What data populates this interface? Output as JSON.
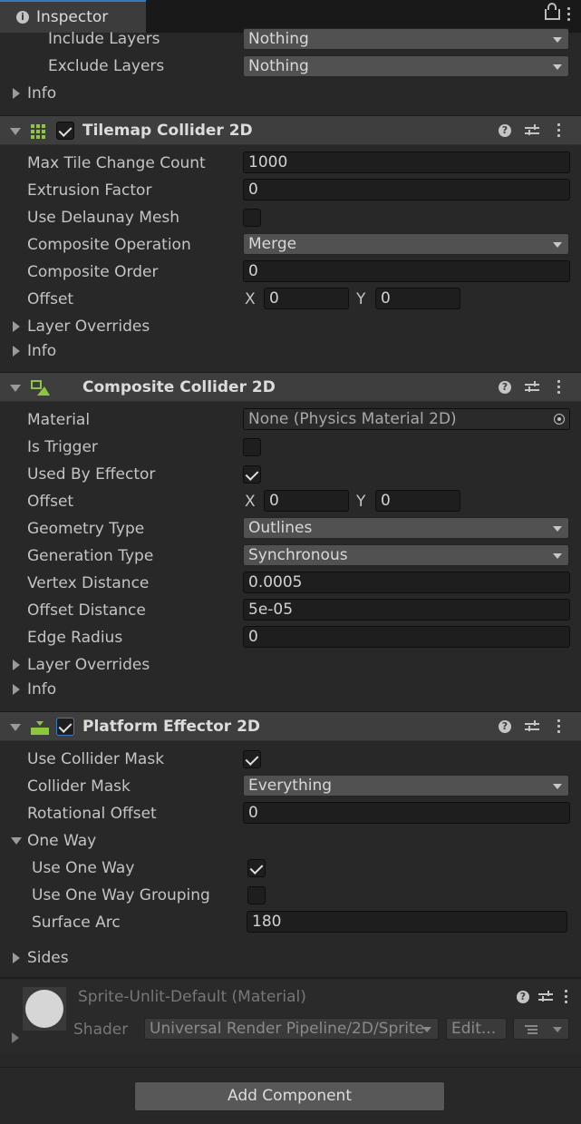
{
  "tab": {
    "title": "Inspector"
  },
  "top": {
    "include_layers": {
      "label": "Include Layers",
      "value": "Nothing"
    },
    "exclude_layers": {
      "label": "Exclude Layers",
      "value": "Nothing"
    },
    "info": "Info"
  },
  "tilemap": {
    "title": "Tilemap Collider 2D",
    "max_tile": {
      "label": "Max Tile Change Count",
      "value": "1000"
    },
    "extrusion": {
      "label": "Extrusion Factor",
      "value": "0"
    },
    "delaunay": {
      "label": "Use Delaunay Mesh"
    },
    "comp_op": {
      "label": "Composite Operation",
      "value": "Merge"
    },
    "comp_order": {
      "label": "Composite Order",
      "value": "0"
    },
    "offset": {
      "label": "Offset",
      "x_label": "X",
      "x": "0",
      "y_label": "Y",
      "y": "0"
    },
    "layer_overrides": "Layer Overrides",
    "info": "Info"
  },
  "composite": {
    "title": "Composite Collider 2D",
    "material": {
      "label": "Material",
      "value": "None (Physics Material 2D)"
    },
    "is_trigger": {
      "label": "Is Trigger"
    },
    "used_by_effector": {
      "label": "Used By Effector"
    },
    "offset": {
      "label": "Offset",
      "x_label": "X",
      "x": "0",
      "y_label": "Y",
      "y": "0"
    },
    "geometry_type": {
      "label": "Geometry Type",
      "value": "Outlines"
    },
    "generation_type": {
      "label": "Generation Type",
      "value": "Synchronous"
    },
    "vertex_distance": {
      "label": "Vertex Distance",
      "value": "0.0005"
    },
    "offset_distance": {
      "label": "Offset Distance",
      "value": "5e-05"
    },
    "edge_radius": {
      "label": "Edge Radius",
      "value": "0"
    },
    "layer_overrides": "Layer Overrides",
    "info": "Info"
  },
  "platform": {
    "title": "Platform Effector 2D",
    "use_collider_mask": {
      "label": "Use Collider Mask"
    },
    "collider_mask": {
      "label": "Collider Mask",
      "value": "Everything"
    },
    "rotational_offset": {
      "label": "Rotational Offset",
      "value": "0"
    },
    "one_way": "One Way",
    "use_one_way": {
      "label": "Use One Way"
    },
    "use_one_way_grouping": {
      "label": "Use One Way Grouping"
    },
    "surface_arc": {
      "label": "Surface Arc",
      "value": "180"
    },
    "sides": "Sides"
  },
  "material_asset": {
    "title": "Sprite-Unlit-Default (Material)",
    "shader_label": "Shader",
    "shader_value": "Universal Render Pipeline/2D/Sprite",
    "edit_label": "Edit..."
  },
  "add_component": "Add Component",
  "colors": {
    "accent": "#3a79bb",
    "icon_green": "#8dc63f"
  }
}
